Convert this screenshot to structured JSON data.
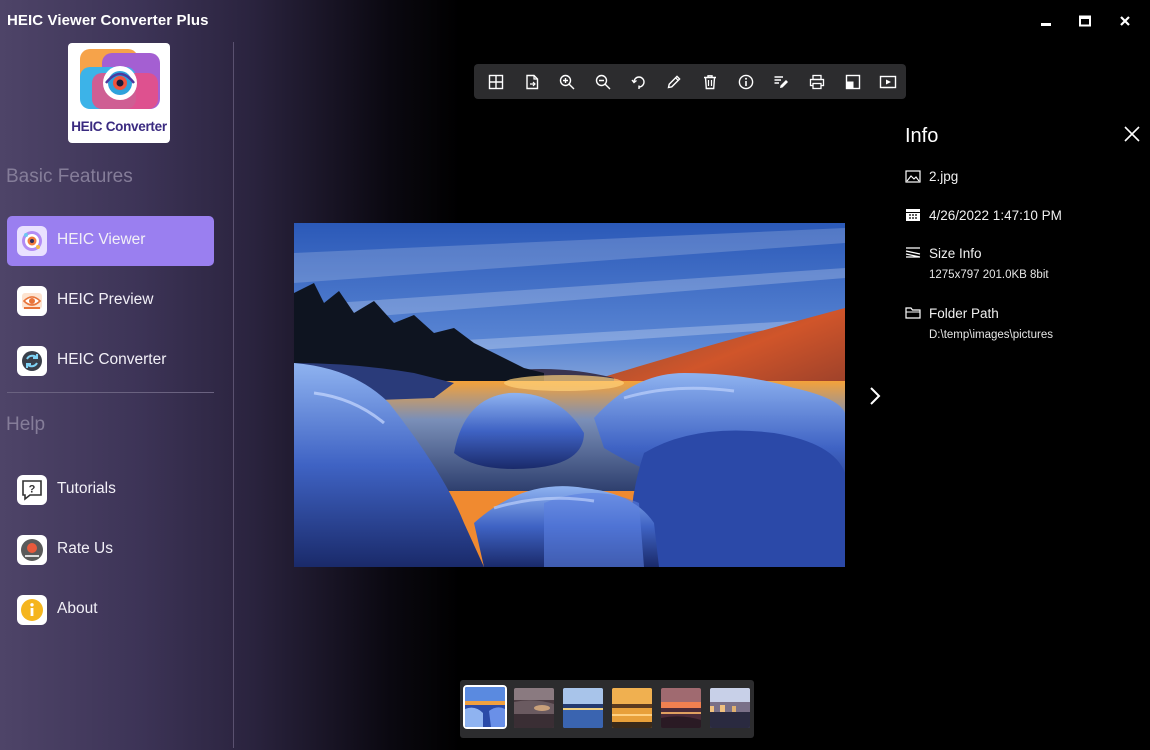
{
  "app": {
    "title": "HEIC Viewer Converter Plus"
  },
  "logo": {
    "text": "HEIC Converter"
  },
  "sidebar": {
    "basic_title": "Basic Features",
    "help_title": "Help",
    "items": [
      {
        "label": "HEIC Viewer",
        "icon": "viewer-icon",
        "active": true
      },
      {
        "label": "HEIC Preview",
        "icon": "preview-eye-icon",
        "active": false
      },
      {
        "label": "HEIC Converter",
        "icon": "converter-cycle-icon",
        "active": false
      },
      {
        "label": "Tutorials",
        "icon": "tutorial-question-icon",
        "active": false
      },
      {
        "label": "Rate Us",
        "icon": "rate-us-icon",
        "active": false
      },
      {
        "label": "About",
        "icon": "about-info-icon",
        "active": false
      }
    ]
  },
  "toolbar": {
    "buttons": [
      "grid-icon",
      "export-file-icon",
      "zoom-in-icon",
      "zoom-out-icon",
      "rotate-icon",
      "edit-pencil-icon",
      "delete-trash-icon",
      "info-icon",
      "rename-icon",
      "print-icon",
      "set-wallpaper-icon",
      "slideshow-icon"
    ]
  },
  "info": {
    "title": "Info",
    "file_name": "2.jpg",
    "date": "4/26/2022 1:47:10 PM",
    "size_label": "Size Info",
    "size_value": "1275x797 201.0KB  8bit",
    "folder_label": "Folder Path",
    "folder_value": "D:\\temp\\images\\pictures"
  },
  "thumbnails": {
    "count": 6,
    "selected": 1
  },
  "colors": {
    "accent": "#9a7ff0",
    "toolbar_bg": "#2c2c2e",
    "sidebar_top": "#4e4468"
  }
}
